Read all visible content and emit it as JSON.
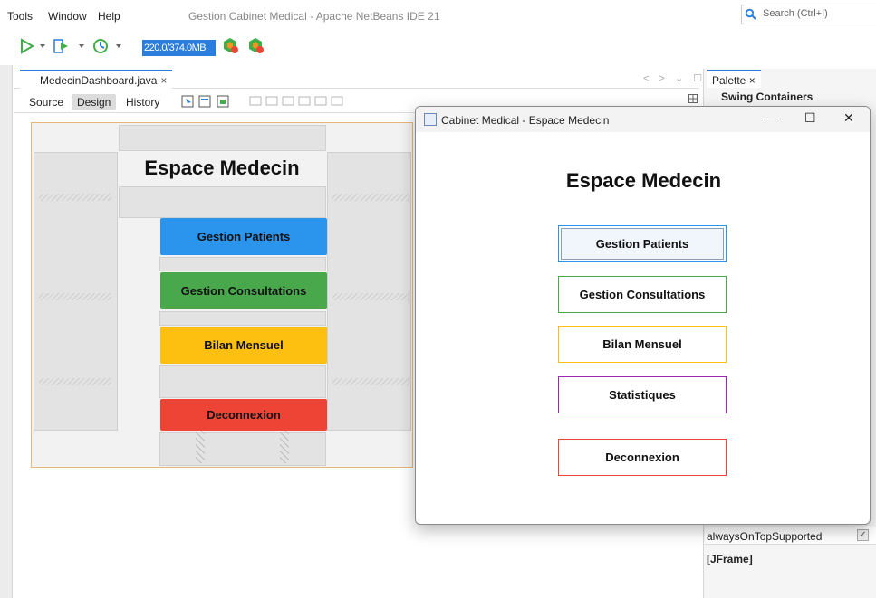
{
  "menu": {
    "items": [
      "Tools",
      "Window",
      "Help"
    ]
  },
  "ide_title": "Gestion Cabinet Medical - Apache NetBeans IDE 21",
  "search": {
    "placeholder": "Search (Ctrl+I)",
    "icon": "search-icon"
  },
  "toolbar": {
    "memory": "220.0/374.0MB"
  },
  "editor": {
    "tab_label": "MedecinDashboard.java",
    "tab_close": "×",
    "modes": [
      "Source",
      "Design",
      "History"
    ],
    "active_mode": "Design"
  },
  "designer": {
    "title": "Espace Medecin",
    "buttons": [
      {
        "label": "Gestion Patients",
        "color": "#2b94ec"
      },
      {
        "label": "Gestion Consultations",
        "color": "#49a84c"
      },
      {
        "label": "Bilan Mensuel",
        "color": "#fdc010"
      },
      {
        "label": "Deconnexion",
        "color": "#ee4436"
      }
    ]
  },
  "palette": {
    "tab_label": "Palette",
    "tab_close": "×",
    "section": "Swing Containers",
    "property_name": "alwaysOnTopSupported",
    "property_checked": true,
    "component": "[JFrame]"
  },
  "window": {
    "title": "Cabinet Medical - Espace Medecin",
    "controls": {
      "minimize": "—",
      "maximize": "☐",
      "close": "✕"
    },
    "heading": "Espace Medecin",
    "buttons": [
      {
        "label": "Gestion Patients",
        "border": "#2b94ec"
      },
      {
        "label": "Gestion Consultations",
        "border": "#49a84c"
      },
      {
        "label": "Bilan Mensuel",
        "border": "#fdc010"
      },
      {
        "label": "Statistiques",
        "border": "#9c27b0"
      },
      {
        "label": "Deconnexion",
        "border": "#ee4436"
      }
    ]
  }
}
